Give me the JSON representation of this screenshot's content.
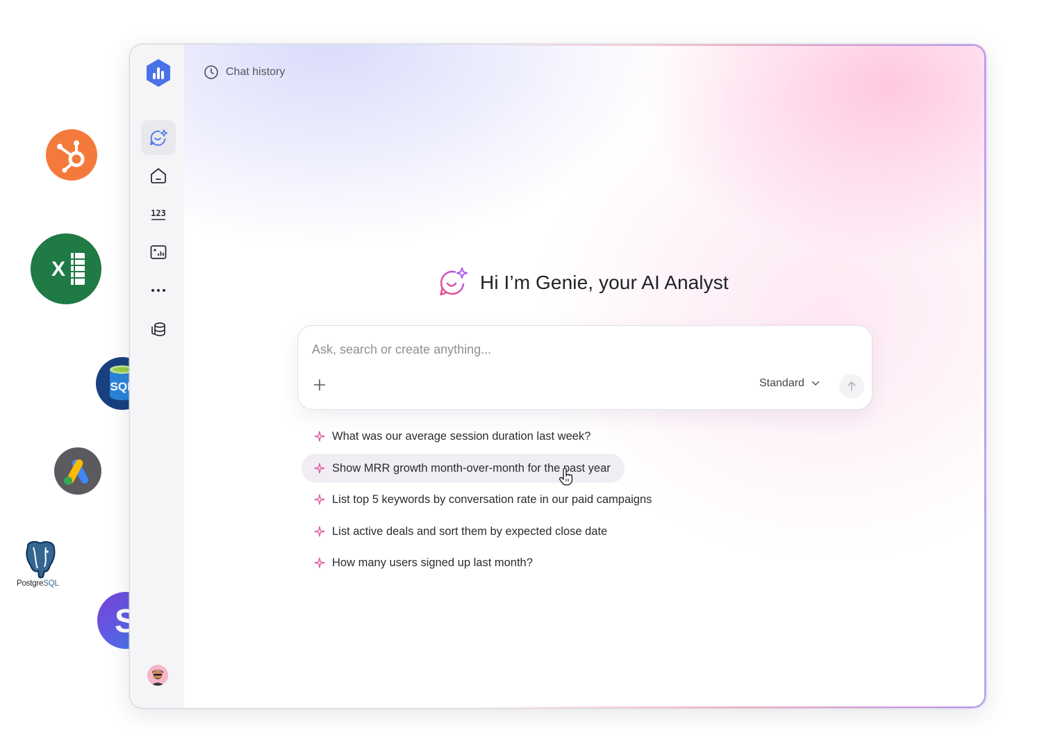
{
  "header": {
    "chat_history_label": "Chat history",
    "chat_history_icon": "clock-icon"
  },
  "sidebar": {
    "logo_icon": "bar-chart-logo-icon",
    "items": [
      {
        "name": "genie-chat",
        "icon": "chat-sparkle-icon",
        "active": true
      },
      {
        "name": "home",
        "icon": "home-icon",
        "active": false
      },
      {
        "name": "metrics",
        "icon": "numbers-123-icon",
        "active": false
      },
      {
        "name": "dashboards",
        "icon": "dashboard-icon",
        "active": false
      },
      {
        "name": "more",
        "icon": "more-dots-icon",
        "active": false
      },
      {
        "name": "data-sources",
        "icon": "database-icon",
        "active": false
      }
    ]
  },
  "greeting": {
    "title": "Hi I’m Genie, your AI Analyst",
    "icon": "genie-sparkle-icon"
  },
  "composer": {
    "placeholder": "Ask, search or create anything...",
    "value": "",
    "mode": "Standard",
    "add_icon": "plus-icon",
    "send_icon": "arrow-up-icon"
  },
  "suggestions": [
    "What was our average session duration last week?",
    "Show MRR growth month-over-month for the past year",
    "List top 5 keywords by conversation rate in our paid campaigns",
    "List active deals and sort them by expected close date",
    "How many users signed up last month?"
  ],
  "integrations": {
    "postgres_wordmark_part1": "Postgre",
    "postgres_wordmark_part2": "SQL",
    "sql_badge": "SQL",
    "stripe_letter": "S",
    "excel_letter": "X"
  },
  "colors": {
    "accent_sparkle": "#e0569f",
    "brand_blue": "#4a72e8",
    "hubspot": "#f47a3c",
    "excel": "#1f7a45",
    "sql_server": "#18407e",
    "google_ads_bg": "#5a5a5f",
    "stripe_purple": "#6b4fd8"
  }
}
